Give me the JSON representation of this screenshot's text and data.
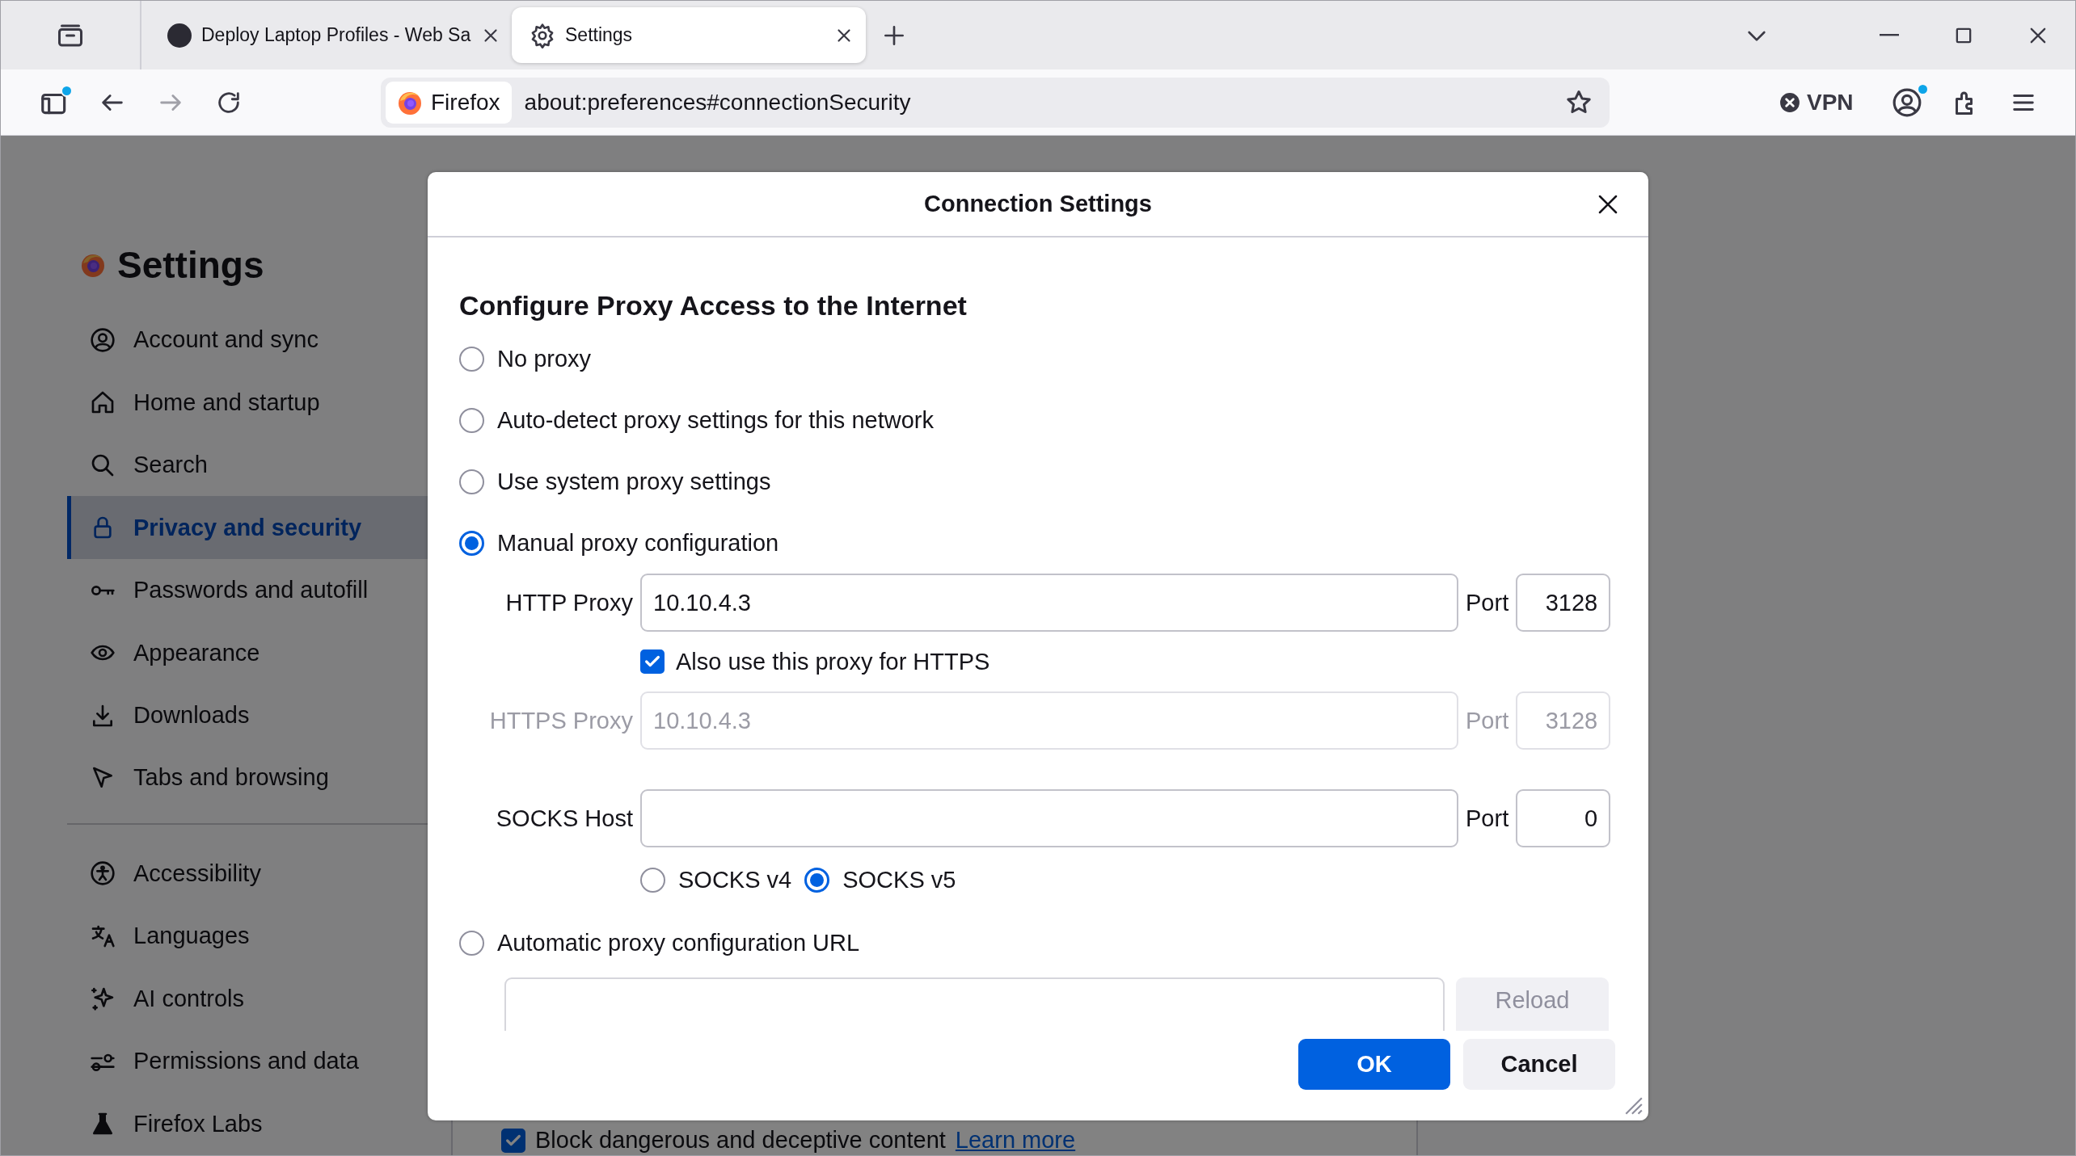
{
  "browser": {
    "tabs": [
      {
        "title": "Deploy Laptop Profiles - Web Sa",
        "selected": false
      },
      {
        "title": "Settings",
        "selected": true
      }
    ],
    "identity": "Firefox",
    "url": "about:preferences#connectionSecurity",
    "vpn": "VPN"
  },
  "settings": {
    "title": "Settings",
    "nav_groups": [
      {
        "items": [
          {
            "label": "Account and sync",
            "selected": false
          },
          {
            "label": "Home and startup",
            "selected": false
          },
          {
            "label": "Search",
            "selected": false
          },
          {
            "label": "Privacy and security",
            "selected": true
          },
          {
            "label": "Passwords and autofill",
            "selected": false
          },
          {
            "label": "Appearance",
            "selected": false
          },
          {
            "label": "Downloads",
            "selected": false
          },
          {
            "label": "Tabs and browsing",
            "selected": false
          }
        ]
      },
      {
        "items": [
          {
            "label": "Accessibility",
            "selected": false
          },
          {
            "label": "Languages",
            "selected": false
          },
          {
            "label": "AI controls",
            "selected": false
          },
          {
            "label": "Permissions and data",
            "selected": false
          },
          {
            "label": "Firefox Labs",
            "selected": false
          }
        ]
      }
    ],
    "option": {
      "label": "Block dangerous and deceptive content",
      "checked": true,
      "link": "Learn more"
    }
  },
  "dialog": {
    "title": "Connection Settings",
    "heading": "Configure Proxy Access to the Internet",
    "modes": [
      {
        "label": "No proxy",
        "selected": false
      },
      {
        "label": "Auto-detect proxy settings for this network",
        "selected": false
      },
      {
        "label": "Use system proxy settings",
        "selected": false
      },
      {
        "label": "Manual proxy configuration",
        "selected": true,
        "manual": {
          "http": {
            "label": "HTTP Proxy",
            "value": "10.10.4.3",
            "port_label": "Port",
            "port": "3128",
            "disabled": false
          },
          "share": {
            "label": "Also use this proxy for HTTPS",
            "checked": true
          },
          "https": {
            "label": "HTTPS Proxy",
            "value": "10.10.4.3",
            "port_label": "Port",
            "port": "3128",
            "disabled": true
          },
          "socks": {
            "label": "SOCKS Host",
            "port_label": "Port",
            "port": "0",
            "disabled": false
          },
          "socks_versions": [
            {
              "label": "SOCKS v4",
              "selected": false
            },
            {
              "label": "SOCKS v5",
              "selected": true
            }
          ]
        }
      },
      {
        "label": "Automatic proxy configuration URL",
        "selected": false,
        "pac": {
          "reload": {
            "label": "Reload",
            "disabled": true
          }
        }
      }
    ],
    "buttons": [
      {
        "label": "OK",
        "kind": "primary"
      },
      {
        "label": "Cancel",
        "kind": "secondary"
      }
    ]
  }
}
